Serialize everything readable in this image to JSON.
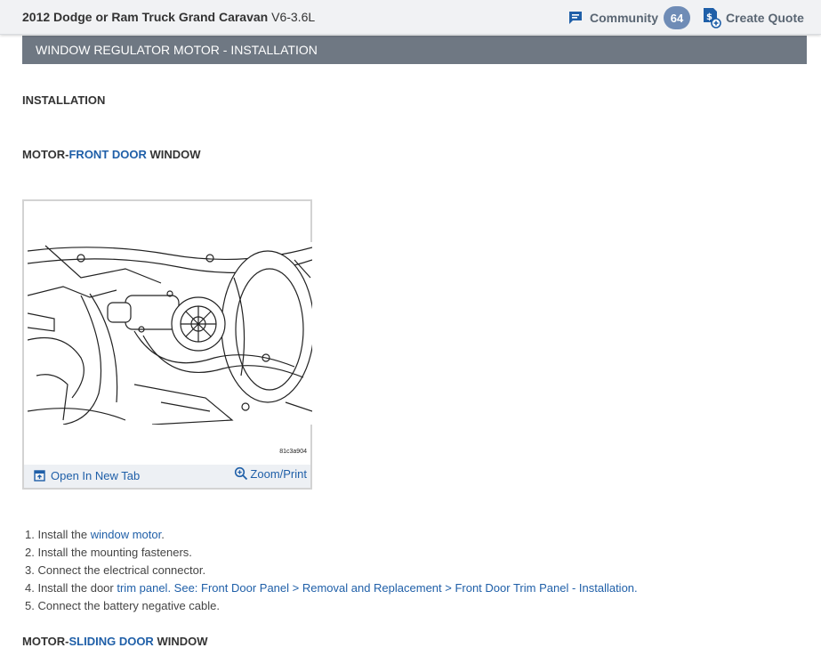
{
  "header": {
    "title": "2012 Dodge or Ram Truck Grand Caravan",
    "engine": "V6-3.6L",
    "community_label": "Community",
    "community_count": "64",
    "create_quote_label": "Create Quote"
  },
  "section_title": "WINDOW REGULATOR MOTOR - INSTALLATION",
  "installation_heading": "INSTALLATION",
  "front_heading": {
    "prefix": "MOTOR-",
    "link": "FRONT DOOR",
    "suffix": " WINDOW"
  },
  "figure": {
    "id": "81c3a904",
    "open_tab_label": "Open In New Tab",
    "zoom_label": "Zoom/Print"
  },
  "steps": [
    {
      "num": "1.",
      "pre": "Install the ",
      "link": "window motor",
      "post": "."
    },
    {
      "num": "2.",
      "pre": "Install the mounting fasteners.",
      "link": "",
      "post": ""
    },
    {
      "num": "3.",
      "pre": "Connect the electrical connector.",
      "link": "",
      "post": ""
    },
    {
      "num": "4.",
      "pre": "Install the door ",
      "link": "trim panel",
      "post": ". ",
      "link2": "See: Front Door Panel > Removal and Replacement > Front Door Trim Panel - Installation",
      "post2": "."
    },
    {
      "num": "5.",
      "pre": "Connect the battery negative cable.",
      "link": "",
      "post": ""
    }
  ],
  "sliding_heading": {
    "prefix": "MOTOR-",
    "link": "SLIDING DOOR",
    "suffix": " WINDOW"
  },
  "colors": {
    "accent": "#1f5fa8",
    "section_bar": "#6f7883",
    "badge": "#6f8cb6"
  }
}
